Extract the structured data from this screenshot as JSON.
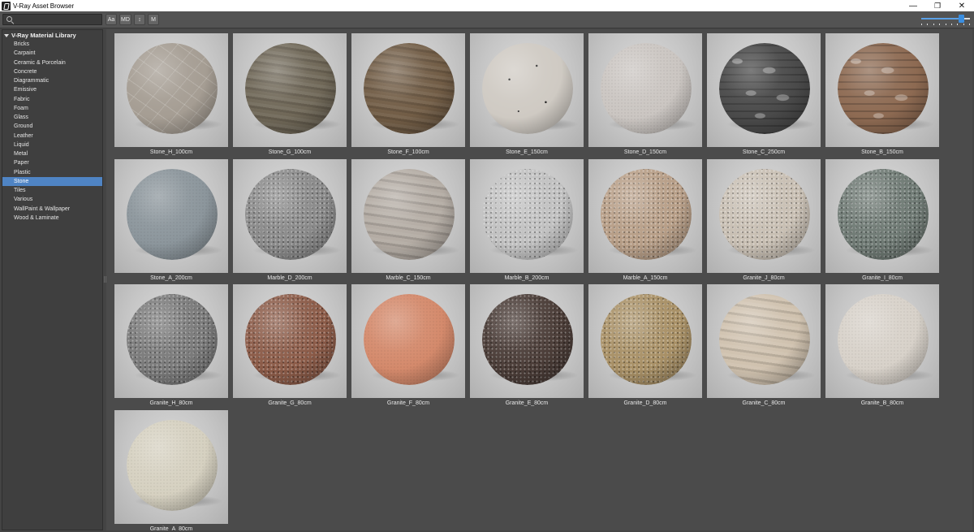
{
  "window": {
    "title": "V-Ray Asset Browser",
    "controls": {
      "minimize": "—",
      "restore": "❐",
      "close": "✕"
    }
  },
  "toolbar": {
    "search_placeholder": "",
    "buttons": [
      "Aa",
      "MD",
      "↕",
      "M"
    ],
    "zoom_level": 0.82
  },
  "sidebar": {
    "root": "V-Ray Material Library",
    "items": [
      "Bricks",
      "Carpaint",
      "Ceramic & Porcelain",
      "Concrete",
      "Diagrammatic",
      "Emissive",
      "Fabric",
      "Foam",
      "Glass",
      "Ground",
      "Leather",
      "Liquid",
      "Metal",
      "Paper",
      "Plastic",
      "Stone",
      "Tiles",
      "Various",
      "WallPaint & Wallpaper",
      "Wood & Laminate"
    ],
    "selected": "Stone"
  },
  "materials": [
    {
      "name": "Stone_H_100cm",
      "color": "#a59d93",
      "pattern": "veins"
    },
    {
      "name": "Stone_G_100cm",
      "color": "#6f6757",
      "pattern": "bands"
    },
    {
      "name": "Stone_F_100cm",
      "color": "#715c45",
      "pattern": "bands"
    },
    {
      "name": "Stone_E_150cm",
      "color": "#cfcac3",
      "pattern": "dots"
    },
    {
      "name": "Stone_D_150cm",
      "color": "#cbc6c2",
      "pattern": "fine"
    },
    {
      "name": "Stone_C_250cm",
      "color": "#4a4a4a",
      "pattern": "pebbles"
    },
    {
      "name": "Stone_B_150cm",
      "color": "#8d6a52",
      "pattern": "pebbles"
    },
    {
      "name": "Stone_A_200cm",
      "color": "#8c969c",
      "pattern": "fine"
    },
    {
      "name": "Marble_D_200cm",
      "color": "#8a8a8a",
      "pattern": "speckle"
    },
    {
      "name": "Marble_C_150cm",
      "color": "#b3aba3",
      "pattern": "bands"
    },
    {
      "name": "Marble_B_200cm",
      "color": "#c1c1c1",
      "pattern": "speckle"
    },
    {
      "name": "Marble_A_150cm",
      "color": "#b79e87",
      "pattern": "speckle"
    },
    {
      "name": "Granite_J_80cm",
      "color": "#c8bfb3",
      "pattern": "speckle"
    },
    {
      "name": "Granite_I_80cm",
      "color": "#6f7a74",
      "pattern": "speckle"
    },
    {
      "name": "Granite_H_80cm",
      "color": "#7a7a7a",
      "pattern": "speckle"
    },
    {
      "name": "Granite_G_80cm",
      "color": "#8b5b48",
      "pattern": "speckle"
    },
    {
      "name": "Granite_F_80cm",
      "color": "#d48a6c",
      "pattern": "fine"
    },
    {
      "name": "Granite_E_80cm",
      "color": "#4b3d38",
      "pattern": "speckle"
    },
    {
      "name": "Granite_D_80cm",
      "color": "#a89066",
      "pattern": "speckle"
    },
    {
      "name": "Granite_C_80cm",
      "color": "#cfc1ae",
      "pattern": "bands"
    },
    {
      "name": "Granite_B_80cm",
      "color": "#d8d2ca",
      "pattern": "fine"
    },
    {
      "name": "Granite_A_80cm",
      "color": "#d6d1c1",
      "pattern": "fine"
    }
  ]
}
